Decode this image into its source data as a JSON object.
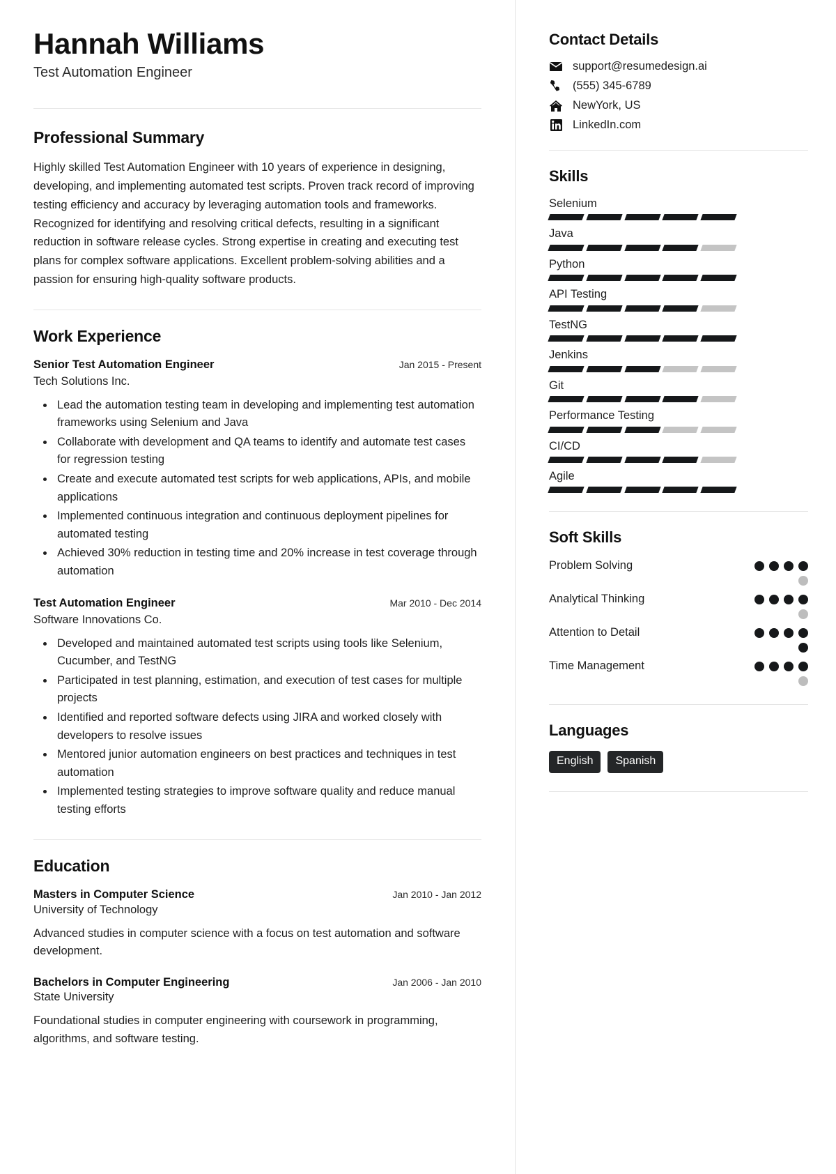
{
  "header": {
    "name": "Hannah Williams",
    "job_title": "Test Automation Engineer"
  },
  "summary": {
    "heading": "Professional Summary",
    "text": "Highly skilled Test Automation Engineer with 10 years of experience in designing, developing, and implementing automated test scripts. Proven track record of improving testing efficiency and accuracy by leveraging automation tools and frameworks. Recognized for identifying and resolving critical defects, resulting in a significant reduction in software release cycles. Strong expertise in creating and executing test plans for complex software applications. Excellent problem-solving abilities and a passion for ensuring high-quality software products."
  },
  "work": {
    "heading": "Work Experience",
    "jobs": [
      {
        "role": "Senior Test Automation Engineer",
        "date": "Jan 2015 - Present",
        "company": "Tech Solutions Inc.",
        "bullets": [
          "Lead the automation testing team in developing and implementing test automation frameworks using Selenium and Java",
          "Collaborate with development and QA teams to identify and automate test cases for regression testing",
          "Create and execute automated test scripts for web applications, APIs, and mobile applications",
          "Implemented continuous integration and continuous deployment pipelines for automated testing",
          "Achieved 30% reduction in testing time and 20% increase in test coverage through automation"
        ]
      },
      {
        "role": "Test Automation Engineer",
        "date": "Mar 2010 - Dec 2014",
        "company": "Software Innovations Co.",
        "bullets": [
          "Developed and maintained automated test scripts using tools like Selenium, Cucumber, and TestNG",
          "Participated in test planning, estimation, and execution of test cases for multiple projects",
          "Identified and reported software defects using JIRA and worked closely with developers to resolve issues",
          "Mentored junior automation engineers on best practices and techniques in test automation",
          "Implemented testing strategies to improve software quality and reduce manual testing efforts"
        ]
      }
    ]
  },
  "education": {
    "heading": "Education",
    "entries": [
      {
        "degree": "Masters in Computer Science",
        "date": "Jan 2010 - Jan 2012",
        "school": "University of Technology",
        "description": "Advanced studies in computer science with a focus on test automation and software development."
      },
      {
        "degree": "Bachelors in Computer Engineering",
        "date": "Jan 2006 - Jan 2010",
        "school": "State University",
        "description": "Foundational studies in computer engineering with coursework in programming, algorithms, and software testing."
      }
    ]
  },
  "contact": {
    "heading": "Contact Details",
    "items": [
      {
        "icon": "envelope-icon",
        "value": "support@resumedesign.ai"
      },
      {
        "icon": "phone-icon",
        "value": "(555) 345-6789"
      },
      {
        "icon": "home-icon",
        "value": "NewYork, US"
      },
      {
        "icon": "linkedin-icon",
        "value": "LinkedIn.com"
      }
    ]
  },
  "skills": {
    "heading": "Skills",
    "max_level": 5,
    "items": [
      {
        "name": "Selenium",
        "level": 5
      },
      {
        "name": "Java",
        "level": 4
      },
      {
        "name": "Python",
        "level": 5
      },
      {
        "name": "API Testing",
        "level": 4
      },
      {
        "name": "TestNG",
        "level": 5
      },
      {
        "name": "Jenkins",
        "level": 3
      },
      {
        "name": "Git",
        "level": 4
      },
      {
        "name": "Performance Testing",
        "level": 3
      },
      {
        "name": "CI/CD",
        "level": 4
      },
      {
        "name": "Agile",
        "level": 5
      }
    ]
  },
  "soft_skills": {
    "heading": "Soft Skills",
    "max_level": 5,
    "items": [
      {
        "name": "Problem Solving",
        "level": 4
      },
      {
        "name": "Analytical Thinking",
        "level": 4
      },
      {
        "name": "Attention to Detail",
        "level": 5
      },
      {
        "name": "Time Management",
        "level": 4
      }
    ]
  },
  "languages": {
    "heading": "Languages",
    "items": [
      "English",
      "Spanish"
    ]
  },
  "colors": {
    "filled": "#16181a",
    "empty": "#c4c4c4",
    "chip_bg": "#242628",
    "divider": "#e4e4e4"
  }
}
